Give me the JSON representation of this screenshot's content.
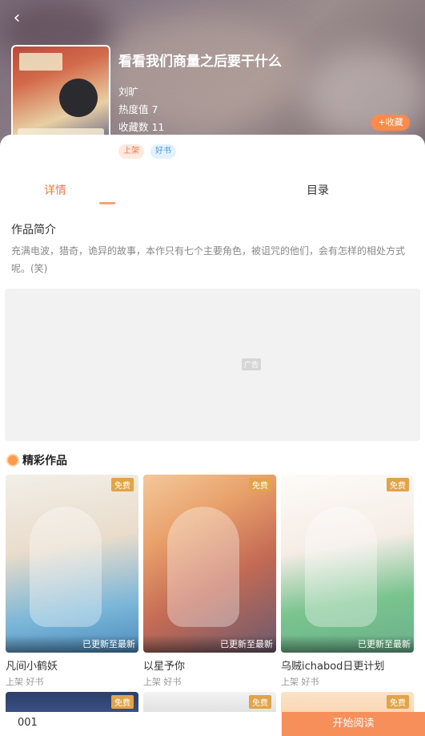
{
  "header": {
    "back_icon": "chevron-left-icon",
    "title": "看看我们商量之后要干什么",
    "author": "刘旷",
    "heat": "热度值 7",
    "favorites": "收藏数 11",
    "fav_button": "+收藏"
  },
  "tags": [
    "上架",
    "好书"
  ],
  "tabs": [
    {
      "label": "详情",
      "active": true
    },
    {
      "label": "目录",
      "active": false
    }
  ],
  "intro": {
    "title": "作品简介",
    "text": "充满电波，猎奇，诡异的故事，本作只有七个主要角色，被诅咒的他们，会有怎样的相处方式呢。(笑)"
  },
  "ad": {
    "label": "广告"
  },
  "featured": {
    "title": "精彩作品",
    "items": [
      {
        "name": "凡间小鹤妖",
        "badge": "免费",
        "update": "已更新至最新",
        "sub": "上架 好书"
      },
      {
        "name": "以星予你",
        "badge": "免费",
        "update": "已更新至最新",
        "sub": "上架 好书"
      },
      {
        "name": "乌贼ichabod日更计划",
        "badge": "免费",
        "update": "已更新至最新",
        "sub": "上架 好书"
      }
    ],
    "row2_badges": [
      "免费",
      "免费",
      "免费"
    ]
  },
  "bottom": {
    "chapter": "001",
    "read_button": "开始阅读"
  },
  "colors": {
    "accent": "#f68f5a",
    "tag_orange": "#f07a4c",
    "tag_blue": "#4a9be0"
  }
}
